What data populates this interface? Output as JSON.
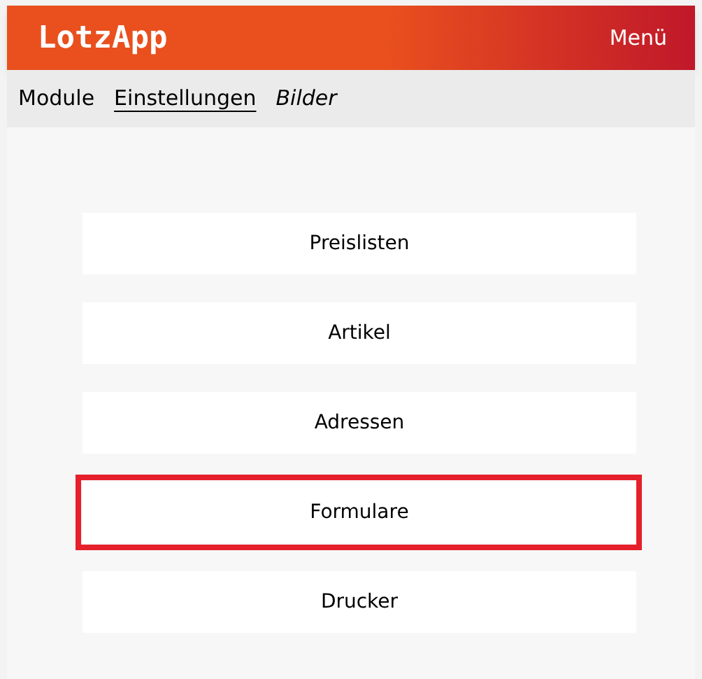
{
  "header": {
    "logo": "LotzApp",
    "menu": "Menü"
  },
  "nav": [
    {
      "label": "Module",
      "selected": false,
      "kind": "normal"
    },
    {
      "label": "Einstellungen",
      "selected": true,
      "kind": "normal"
    },
    {
      "label": "Bilder",
      "selected": false,
      "kind": "italic"
    }
  ],
  "items": [
    {
      "label": "Preislisten",
      "highlighted": false
    },
    {
      "label": "Artikel",
      "highlighted": false
    },
    {
      "label": "Adressen",
      "highlighted": false
    },
    {
      "label": "Formulare",
      "highlighted": true
    },
    {
      "label": "Drucker",
      "highlighted": false
    }
  ]
}
